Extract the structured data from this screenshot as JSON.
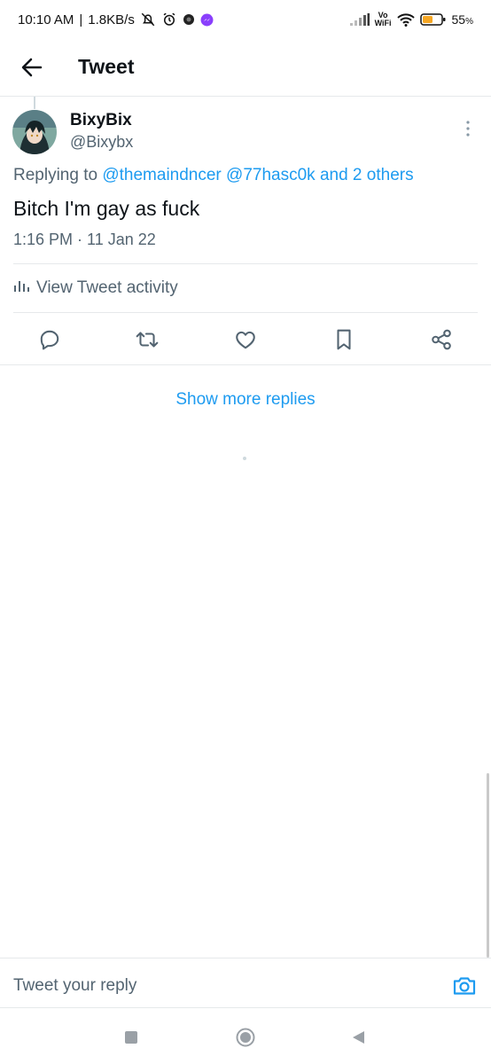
{
  "status_bar": {
    "time": "10:10 AM",
    "speed": "1.8KB/s",
    "volte": "Vo",
    "wifi_label": "WiFi",
    "battery": "55",
    "battery_unit": "%",
    "battery_level": 0.55
  },
  "header": {
    "title": "Tweet"
  },
  "tweet": {
    "display_name": "BixyBix",
    "handle": "@Bixybx",
    "replying_prefix": "Replying to",
    "mention_1": "@themaindncer",
    "mention_2": "@77hasc0k",
    "replying_and": "and 2 others",
    "text": "Bitch I'm gay as fuck",
    "timestamp": "1:16 PM · 11 Jan 22"
  },
  "activity": {
    "label": "View Tweet activity"
  },
  "actions": [
    "reply-icon",
    "retweet-icon",
    "like-icon",
    "bookmark-icon",
    "share-icon"
  ],
  "show_more": {
    "label": "Show more replies"
  },
  "reply_bar": {
    "placeholder": "Tweet your reply"
  },
  "colors": {
    "accent": "#1d9bf0",
    "secondary_text": "#536471",
    "primary_text": "#0f1419",
    "divider": "#e6e9eb"
  }
}
